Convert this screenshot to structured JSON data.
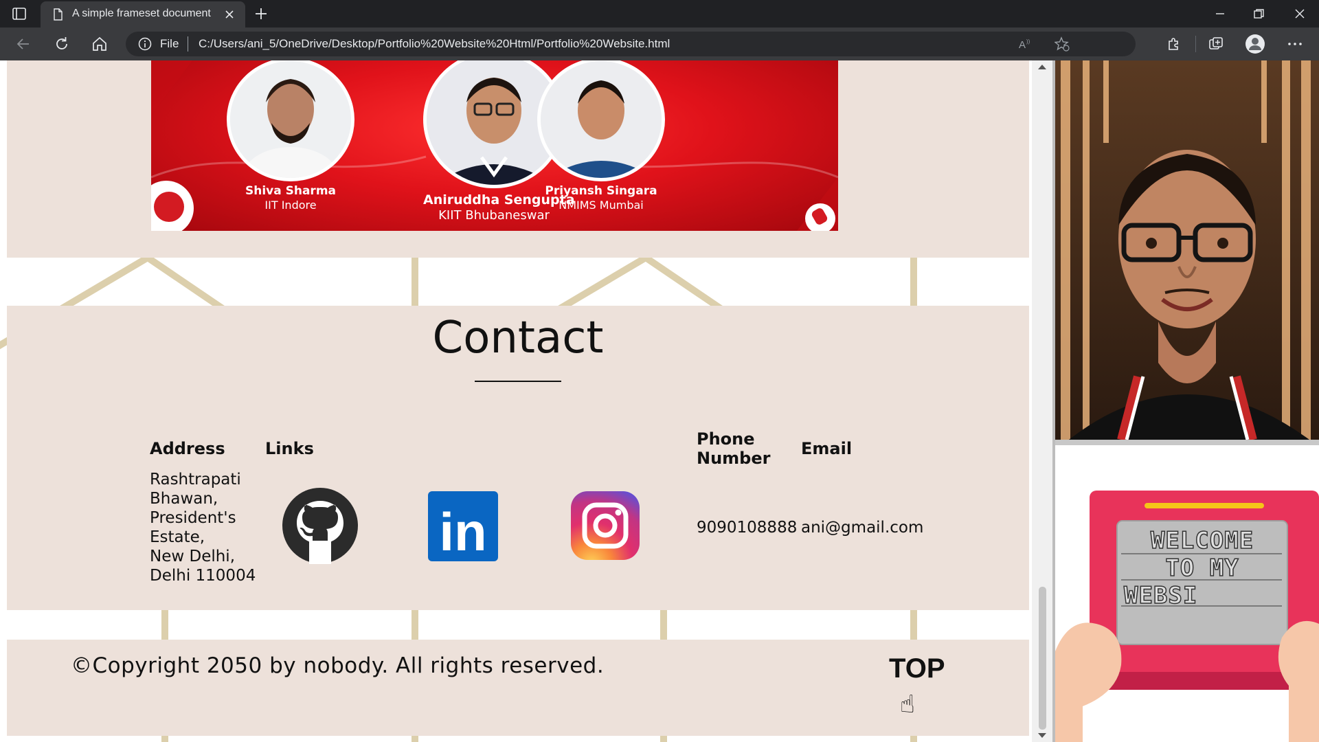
{
  "browser": {
    "tab_title": "A simple frameset document",
    "file_label": "File",
    "url": "C:/Users/ani_5/OneDrive/Desktop/Portfolio%20Website%20Html/Portfolio%20Website.html"
  },
  "banner": {
    "people": [
      {
        "name": "Shiva Sharma",
        "school": "IIT Indore"
      },
      {
        "name": "Aniruddha Sengupta",
        "school": "KIIT Bhubaneswar"
      },
      {
        "name": "Priyansh Singara",
        "school": "NMIMS Mumbai"
      }
    ]
  },
  "contact": {
    "title": "Contact",
    "address_head": "Address",
    "links_head": "Links",
    "phone_head": "Phone Number",
    "email_head": "Email",
    "address_lines": [
      "Rashtrapati",
      "Bhawan,",
      "President's",
      "Estate,",
      "New Delhi,",
      "Delhi 110004"
    ],
    "phone": "9090108888",
    "email": "ani@gmail.com",
    "links": [
      {
        "name": "github",
        "icon": "github-icon"
      },
      {
        "name": "linkedin",
        "icon": "linkedin-icon",
        "label": "in"
      },
      {
        "name": "instagram",
        "icon": "instagram-icon"
      }
    ]
  },
  "footer": {
    "copyright": "©Copyright 2050 by nobody. All rights reserved.",
    "top_label": "TOP",
    "top_hand": "☝"
  },
  "side": {
    "welcome_text": [
      "WELCOME",
      "TO MY",
      "WEBSI"
    ]
  },
  "colors": {
    "panel": "#ede1da",
    "pattern": "#dccfac",
    "banner_red": "#e0121a",
    "tablet_pink": "#e8335a",
    "tablet_yellow": "#f5c518"
  }
}
